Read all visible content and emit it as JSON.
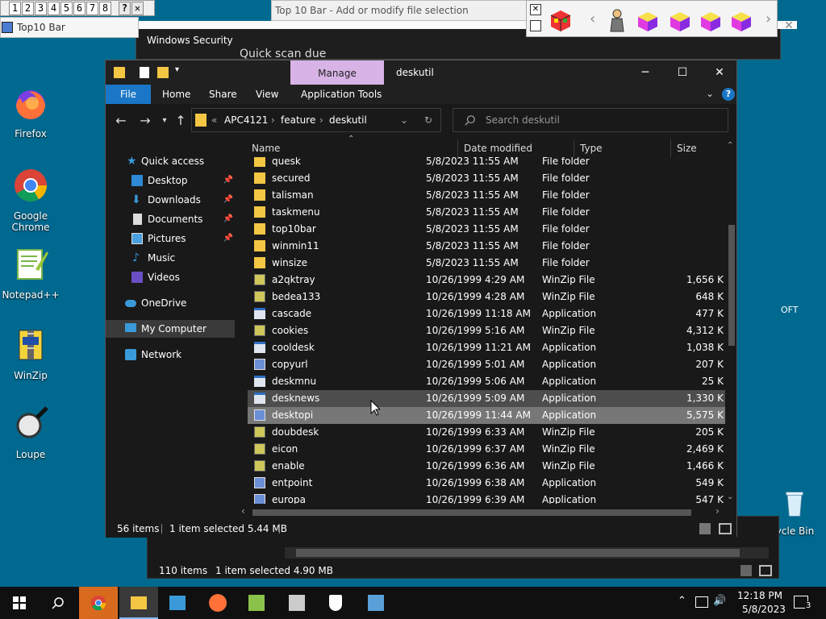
{
  "topbar": {
    "numbers": [
      "1",
      "2",
      "3",
      "4",
      "5",
      "6",
      "7",
      "8"
    ],
    "help": "?",
    "close": "✕",
    "top10_window_title": "Top10 Bar",
    "addmod_title": "Top 10 Bar - Add or modify file selection"
  },
  "desktop": {
    "icons": [
      {
        "label": "Firefox"
      },
      {
        "label": "Google Chrome"
      },
      {
        "label": "Notepad++"
      },
      {
        "label": "WinZip"
      },
      {
        "label": "Loupe"
      }
    ]
  },
  "back_windows": {
    "windows_security_title": "Windows Security",
    "quick_scan": "Quick scan due",
    "back_status_count": "110 items",
    "back_status_selected": "1 item selected  4.90 MB"
  },
  "explorer": {
    "manage_tab": "Manage",
    "title": "deskutil",
    "ribbon_tabs": [
      "File",
      "Home",
      "Share",
      "View",
      "Application Tools"
    ],
    "address": {
      "prefix": "«",
      "segments": [
        "APC4121",
        "feature",
        "deskutil"
      ],
      "separator": "›"
    },
    "search_placeholder": "Search deskutil",
    "nav": {
      "quick_access": "Quick access",
      "items": [
        {
          "label": "Desktop",
          "pinned": true
        },
        {
          "label": "Downloads",
          "pinned": true
        },
        {
          "label": "Documents",
          "pinned": true
        },
        {
          "label": "Pictures",
          "pinned": true
        },
        {
          "label": "Music",
          "pinned": false
        },
        {
          "label": "Videos",
          "pinned": false
        }
      ],
      "onedrive": "OneDrive",
      "my_computer": "My Computer",
      "network": "Network"
    },
    "columns": [
      "Name",
      "Date modified",
      "Type",
      "Size"
    ],
    "files": [
      {
        "name": "quesk",
        "date": "5/8/2023 11:55 AM",
        "type": "File folder",
        "size": "",
        "kind": "folder"
      },
      {
        "name": "secured",
        "date": "5/8/2023 11:55 AM",
        "type": "File folder",
        "size": "",
        "kind": "folder"
      },
      {
        "name": "talisman",
        "date": "5/8/2023 11:55 AM",
        "type": "File folder",
        "size": "",
        "kind": "folder"
      },
      {
        "name": "taskmenu",
        "date": "5/8/2023 11:55 AM",
        "type": "File folder",
        "size": "",
        "kind": "folder"
      },
      {
        "name": "top10bar",
        "date": "5/8/2023 11:55 AM",
        "type": "File folder",
        "size": "",
        "kind": "folder"
      },
      {
        "name": "winmin11",
        "date": "5/8/2023 11:55 AM",
        "type": "File folder",
        "size": "",
        "kind": "folder"
      },
      {
        "name": "winsize",
        "date": "5/8/2023 11:55 AM",
        "type": "File folder",
        "size": "",
        "kind": "folder"
      },
      {
        "name": "a2qktray",
        "date": "10/26/1999 4:29 AM",
        "type": "WinZip File",
        "size": "1,656 K",
        "kind": "zip"
      },
      {
        "name": "bedea133",
        "date": "10/26/1999 4:28 AM",
        "type": "WinZip File",
        "size": "648 K",
        "kind": "zip"
      },
      {
        "name": "cascade",
        "date": "10/26/1999 11:18 AM",
        "type": "Application",
        "size": "477 K",
        "kind": "app"
      },
      {
        "name": "cookies",
        "date": "10/26/1999 5:16 AM",
        "type": "WinZip File",
        "size": "4,312 K",
        "kind": "zip"
      },
      {
        "name": "cooldesk",
        "date": "10/26/1999 11:21 AM",
        "type": "Application",
        "size": "1,038 K",
        "kind": "app"
      },
      {
        "name": "copyurl",
        "date": "10/26/1999 5:01 AM",
        "type": "Application",
        "size": "207 K",
        "kind": "setup"
      },
      {
        "name": "deskmnu",
        "date": "10/26/1999 5:06 AM",
        "type": "Application",
        "size": "25 K",
        "kind": "app"
      },
      {
        "name": "desknews",
        "date": "10/26/1999 5:09 AM",
        "type": "Application",
        "size": "1,330 K",
        "kind": "app"
      },
      {
        "name": "desktopi",
        "date": "10/26/1999 11:44 AM",
        "type": "Application",
        "size": "5,575 K",
        "kind": "setup"
      },
      {
        "name": "doubdesk",
        "date": "10/26/1999 6:33 AM",
        "type": "WinZip File",
        "size": "205 K",
        "kind": "zip"
      },
      {
        "name": "eicon",
        "date": "10/26/1999 6:37 AM",
        "type": "WinZip File",
        "size": "2,469 K",
        "kind": "zip"
      },
      {
        "name": "enable",
        "date": "10/26/1999 6:36 AM",
        "type": "WinZip File",
        "size": "1,466 K",
        "kind": "zip"
      },
      {
        "name": "entpoint",
        "date": "10/26/1999 6:38 AM",
        "type": "Application",
        "size": "549 K",
        "kind": "setup"
      },
      {
        "name": "europa",
        "date": "10/26/1999 6:39 AM",
        "type": "Application",
        "size": "547 K",
        "kind": "setup"
      }
    ],
    "status_count": "56 items",
    "status_selected": "1 item selected  5.44 MB"
  },
  "taskbar": {
    "time": "12:18 PM",
    "date": "5/8/2023",
    "notification_count": "3",
    "recycle_bin_label": "Recycle Bin",
    "edge_text": "OFT"
  },
  "colors": {
    "accent": "#1a76c6",
    "manage": "#d7b3e6",
    "folder": "#f3c644",
    "selected_row": "#777777",
    "hover_row": "#4d4d4d"
  }
}
